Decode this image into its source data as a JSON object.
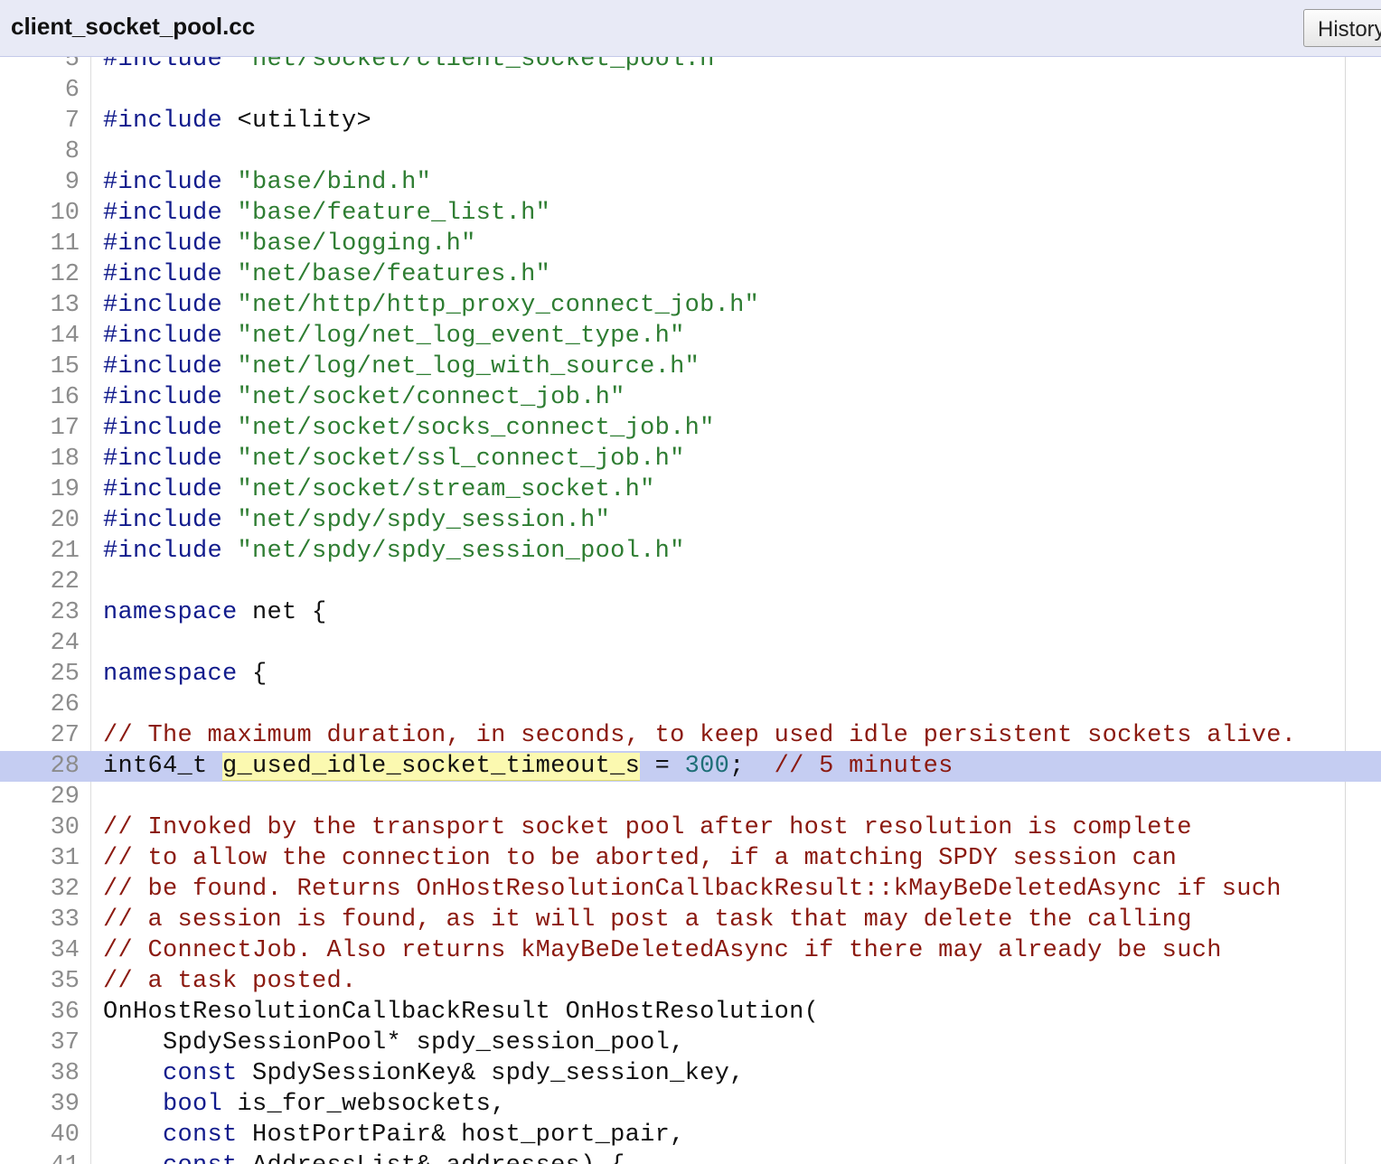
{
  "header": {
    "filename": "client_socket_pool.cc",
    "history_label": "History"
  },
  "colors": {
    "header_bg": "#e8eaf6",
    "keyword": "#111b8c",
    "string": "#2e7d32",
    "comment": "#8b1a10",
    "number": "#1e6f77",
    "highlight_line": "#c5cdf2",
    "highlight_symbol": "#fbf9b0"
  },
  "editor": {
    "highlighted_line": 28,
    "highlighted_symbol": "g_used_idle_socket_timeout_s",
    "lines": [
      {
        "n": "5",
        "tokens": [
          {
            "t": "pp",
            "v": "#include"
          },
          {
            "t": "p",
            "v": " "
          },
          {
            "t": "str",
            "v": "\"net/socket/client_socket_pool.h\""
          }
        ]
      },
      {
        "n": "6",
        "tokens": []
      },
      {
        "n": "7",
        "tokens": [
          {
            "t": "pp",
            "v": "#include"
          },
          {
            "t": "p",
            "v": " <utility>"
          }
        ]
      },
      {
        "n": "8",
        "tokens": []
      },
      {
        "n": "9",
        "tokens": [
          {
            "t": "pp",
            "v": "#include"
          },
          {
            "t": "p",
            "v": " "
          },
          {
            "t": "str",
            "v": "\"base/bind.h\""
          }
        ]
      },
      {
        "n": "10",
        "tokens": [
          {
            "t": "pp",
            "v": "#include"
          },
          {
            "t": "p",
            "v": " "
          },
          {
            "t": "str",
            "v": "\"base/feature_list.h\""
          }
        ]
      },
      {
        "n": "11",
        "tokens": [
          {
            "t": "pp",
            "v": "#include"
          },
          {
            "t": "p",
            "v": " "
          },
          {
            "t": "str",
            "v": "\"base/logging.h\""
          }
        ]
      },
      {
        "n": "12",
        "tokens": [
          {
            "t": "pp",
            "v": "#include"
          },
          {
            "t": "p",
            "v": " "
          },
          {
            "t": "str",
            "v": "\"net/base/features.h\""
          }
        ]
      },
      {
        "n": "13",
        "tokens": [
          {
            "t": "pp",
            "v": "#include"
          },
          {
            "t": "p",
            "v": " "
          },
          {
            "t": "str",
            "v": "\"net/http/http_proxy_connect_job.h\""
          }
        ]
      },
      {
        "n": "14",
        "tokens": [
          {
            "t": "pp",
            "v": "#include"
          },
          {
            "t": "p",
            "v": " "
          },
          {
            "t": "str",
            "v": "\"net/log/net_log_event_type.h\""
          }
        ]
      },
      {
        "n": "15",
        "tokens": [
          {
            "t": "pp",
            "v": "#include"
          },
          {
            "t": "p",
            "v": " "
          },
          {
            "t": "str",
            "v": "\"net/log/net_log_with_source.h\""
          }
        ]
      },
      {
        "n": "16",
        "tokens": [
          {
            "t": "pp",
            "v": "#include"
          },
          {
            "t": "p",
            "v": " "
          },
          {
            "t": "str",
            "v": "\"net/socket/connect_job.h\""
          }
        ]
      },
      {
        "n": "17",
        "tokens": [
          {
            "t": "pp",
            "v": "#include"
          },
          {
            "t": "p",
            "v": " "
          },
          {
            "t": "str",
            "v": "\"net/socket/socks_connect_job.h\""
          }
        ]
      },
      {
        "n": "18",
        "tokens": [
          {
            "t": "pp",
            "v": "#include"
          },
          {
            "t": "p",
            "v": " "
          },
          {
            "t": "str",
            "v": "\"net/socket/ssl_connect_job.h\""
          }
        ]
      },
      {
        "n": "19",
        "tokens": [
          {
            "t": "pp",
            "v": "#include"
          },
          {
            "t": "p",
            "v": " "
          },
          {
            "t": "str",
            "v": "\"net/socket/stream_socket.h\""
          }
        ]
      },
      {
        "n": "20",
        "tokens": [
          {
            "t": "pp",
            "v": "#include"
          },
          {
            "t": "p",
            "v": " "
          },
          {
            "t": "str",
            "v": "\"net/spdy/spdy_session.h\""
          }
        ]
      },
      {
        "n": "21",
        "tokens": [
          {
            "t": "pp",
            "v": "#include"
          },
          {
            "t": "p",
            "v": " "
          },
          {
            "t": "str",
            "v": "\"net/spdy/spdy_session_pool.h\""
          }
        ]
      },
      {
        "n": "22",
        "tokens": []
      },
      {
        "n": "23",
        "tokens": [
          {
            "t": "kw",
            "v": "namespace"
          },
          {
            "t": "p",
            "v": " net {"
          }
        ]
      },
      {
        "n": "24",
        "tokens": []
      },
      {
        "n": "25",
        "tokens": [
          {
            "t": "kw",
            "v": "namespace"
          },
          {
            "t": "p",
            "v": " {"
          }
        ]
      },
      {
        "n": "26",
        "tokens": []
      },
      {
        "n": "27",
        "tokens": [
          {
            "t": "cm",
            "v": "// The maximum duration, in seconds, to keep used idle persistent sockets alive."
          }
        ]
      },
      {
        "n": "28",
        "tokens": [
          {
            "t": "p",
            "v": "int64_t "
          },
          {
            "t": "mark",
            "v": "g_used_idle_socket_timeout_s"
          },
          {
            "t": "p",
            "v": " = "
          },
          {
            "t": "num",
            "v": "300"
          },
          {
            "t": "p",
            "v": ";  "
          },
          {
            "t": "cm",
            "v": "// 5 minutes"
          }
        ]
      },
      {
        "n": "29",
        "tokens": []
      },
      {
        "n": "30",
        "tokens": [
          {
            "t": "cm",
            "v": "// Invoked by the transport socket pool after host resolution is complete"
          }
        ]
      },
      {
        "n": "31",
        "tokens": [
          {
            "t": "cm",
            "v": "// to allow the connection to be aborted, if a matching SPDY session can"
          }
        ]
      },
      {
        "n": "32",
        "tokens": [
          {
            "t": "cm",
            "v": "// be found. Returns OnHostResolutionCallbackResult::kMayBeDeletedAsync if such"
          }
        ]
      },
      {
        "n": "33",
        "tokens": [
          {
            "t": "cm",
            "v": "// a session is found, as it will post a task that may delete the calling"
          }
        ]
      },
      {
        "n": "34",
        "tokens": [
          {
            "t": "cm",
            "v": "// ConnectJob. Also returns kMayBeDeletedAsync if there may already be such"
          }
        ]
      },
      {
        "n": "35",
        "tokens": [
          {
            "t": "cm",
            "v": "// a task posted."
          }
        ]
      },
      {
        "n": "36",
        "tokens": [
          {
            "t": "p",
            "v": "OnHostResolutionCallbackResult OnHostResolution("
          }
        ]
      },
      {
        "n": "37",
        "tokens": [
          {
            "t": "p",
            "v": "    SpdySessionPool* spdy_session_pool,"
          }
        ]
      },
      {
        "n": "38",
        "tokens": [
          {
            "t": "p",
            "v": "    "
          },
          {
            "t": "kw",
            "v": "const"
          },
          {
            "t": "p",
            "v": " SpdySessionKey& spdy_session_key,"
          }
        ]
      },
      {
        "n": "39",
        "tokens": [
          {
            "t": "p",
            "v": "    "
          },
          {
            "t": "kw",
            "v": "bool"
          },
          {
            "t": "p",
            "v": " is_for_websockets,"
          }
        ]
      },
      {
        "n": "40",
        "tokens": [
          {
            "t": "p",
            "v": "    "
          },
          {
            "t": "kw",
            "v": "const"
          },
          {
            "t": "p",
            "v": " HostPortPair& host_port_pair,"
          }
        ]
      },
      {
        "n": "41",
        "tokens": [
          {
            "t": "p",
            "v": "    "
          },
          {
            "t": "kw",
            "v": "const"
          },
          {
            "t": "p",
            "v": " AddressList& addresses) {"
          }
        ]
      }
    ]
  }
}
